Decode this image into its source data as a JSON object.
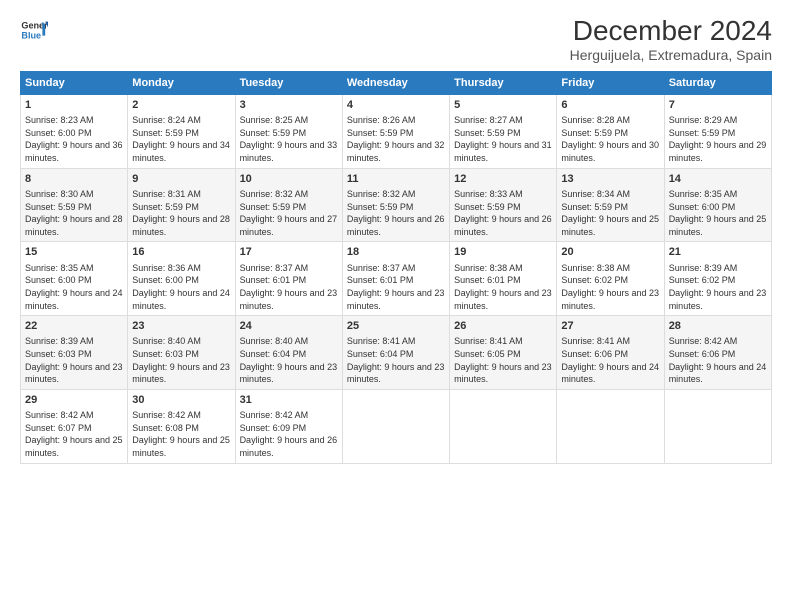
{
  "logo": {
    "line1": "General",
    "line2": "Blue"
  },
  "title": "December 2024",
  "subtitle": "Herguijuela, Extremadura, Spain",
  "header": {
    "days": [
      "Sunday",
      "Monday",
      "Tuesday",
      "Wednesday",
      "Thursday",
      "Friday",
      "Saturday"
    ]
  },
  "rows": [
    [
      {
        "day": "1",
        "rise": "Sunrise: 8:23 AM",
        "set": "Sunset: 6:00 PM",
        "light": "Daylight: 9 hours and 36 minutes."
      },
      {
        "day": "2",
        "rise": "Sunrise: 8:24 AM",
        "set": "Sunset: 5:59 PM",
        "light": "Daylight: 9 hours and 34 minutes."
      },
      {
        "day": "3",
        "rise": "Sunrise: 8:25 AM",
        "set": "Sunset: 5:59 PM",
        "light": "Daylight: 9 hours and 33 minutes."
      },
      {
        "day": "4",
        "rise": "Sunrise: 8:26 AM",
        "set": "Sunset: 5:59 PM",
        "light": "Daylight: 9 hours and 32 minutes."
      },
      {
        "day": "5",
        "rise": "Sunrise: 8:27 AM",
        "set": "Sunset: 5:59 PM",
        "light": "Daylight: 9 hours and 31 minutes."
      },
      {
        "day": "6",
        "rise": "Sunrise: 8:28 AM",
        "set": "Sunset: 5:59 PM",
        "light": "Daylight: 9 hours and 30 minutes."
      },
      {
        "day": "7",
        "rise": "Sunrise: 8:29 AM",
        "set": "Sunset: 5:59 PM",
        "light": "Daylight: 9 hours and 29 minutes."
      }
    ],
    [
      {
        "day": "8",
        "rise": "Sunrise: 8:30 AM",
        "set": "Sunset: 5:59 PM",
        "light": "Daylight: 9 hours and 28 minutes."
      },
      {
        "day": "9",
        "rise": "Sunrise: 8:31 AM",
        "set": "Sunset: 5:59 PM",
        "light": "Daylight: 9 hours and 28 minutes."
      },
      {
        "day": "10",
        "rise": "Sunrise: 8:32 AM",
        "set": "Sunset: 5:59 PM",
        "light": "Daylight: 9 hours and 27 minutes."
      },
      {
        "day": "11",
        "rise": "Sunrise: 8:32 AM",
        "set": "Sunset: 5:59 PM",
        "light": "Daylight: 9 hours and 26 minutes."
      },
      {
        "day": "12",
        "rise": "Sunrise: 8:33 AM",
        "set": "Sunset: 5:59 PM",
        "light": "Daylight: 9 hours and 26 minutes."
      },
      {
        "day": "13",
        "rise": "Sunrise: 8:34 AM",
        "set": "Sunset: 5:59 PM",
        "light": "Daylight: 9 hours and 25 minutes."
      },
      {
        "day": "14",
        "rise": "Sunrise: 8:35 AM",
        "set": "Sunset: 6:00 PM",
        "light": "Daylight: 9 hours and 25 minutes."
      }
    ],
    [
      {
        "day": "15",
        "rise": "Sunrise: 8:35 AM",
        "set": "Sunset: 6:00 PM",
        "light": "Daylight: 9 hours and 24 minutes."
      },
      {
        "day": "16",
        "rise": "Sunrise: 8:36 AM",
        "set": "Sunset: 6:00 PM",
        "light": "Daylight: 9 hours and 24 minutes."
      },
      {
        "day": "17",
        "rise": "Sunrise: 8:37 AM",
        "set": "Sunset: 6:01 PM",
        "light": "Daylight: 9 hours and 23 minutes."
      },
      {
        "day": "18",
        "rise": "Sunrise: 8:37 AM",
        "set": "Sunset: 6:01 PM",
        "light": "Daylight: 9 hours and 23 minutes."
      },
      {
        "day": "19",
        "rise": "Sunrise: 8:38 AM",
        "set": "Sunset: 6:01 PM",
        "light": "Daylight: 9 hours and 23 minutes."
      },
      {
        "day": "20",
        "rise": "Sunrise: 8:38 AM",
        "set": "Sunset: 6:02 PM",
        "light": "Daylight: 9 hours and 23 minutes."
      },
      {
        "day": "21",
        "rise": "Sunrise: 8:39 AM",
        "set": "Sunset: 6:02 PM",
        "light": "Daylight: 9 hours and 23 minutes."
      }
    ],
    [
      {
        "day": "22",
        "rise": "Sunrise: 8:39 AM",
        "set": "Sunset: 6:03 PM",
        "light": "Daylight: 9 hours and 23 minutes."
      },
      {
        "day": "23",
        "rise": "Sunrise: 8:40 AM",
        "set": "Sunset: 6:03 PM",
        "light": "Daylight: 9 hours and 23 minutes."
      },
      {
        "day": "24",
        "rise": "Sunrise: 8:40 AM",
        "set": "Sunset: 6:04 PM",
        "light": "Daylight: 9 hours and 23 minutes."
      },
      {
        "day": "25",
        "rise": "Sunrise: 8:41 AM",
        "set": "Sunset: 6:04 PM",
        "light": "Daylight: 9 hours and 23 minutes."
      },
      {
        "day": "26",
        "rise": "Sunrise: 8:41 AM",
        "set": "Sunset: 6:05 PM",
        "light": "Daylight: 9 hours and 23 minutes."
      },
      {
        "day": "27",
        "rise": "Sunrise: 8:41 AM",
        "set": "Sunset: 6:06 PM",
        "light": "Daylight: 9 hours and 24 minutes."
      },
      {
        "day": "28",
        "rise": "Sunrise: 8:42 AM",
        "set": "Sunset: 6:06 PM",
        "light": "Daylight: 9 hours and 24 minutes."
      }
    ],
    [
      {
        "day": "29",
        "rise": "Sunrise: 8:42 AM",
        "set": "Sunset: 6:07 PM",
        "light": "Daylight: 9 hours and 25 minutes."
      },
      {
        "day": "30",
        "rise": "Sunrise: 8:42 AM",
        "set": "Sunset: 6:08 PM",
        "light": "Daylight: 9 hours and 25 minutes."
      },
      {
        "day": "31",
        "rise": "Sunrise: 8:42 AM",
        "set": "Sunset: 6:09 PM",
        "light": "Daylight: 9 hours and 26 minutes."
      },
      null,
      null,
      null,
      null
    ]
  ]
}
